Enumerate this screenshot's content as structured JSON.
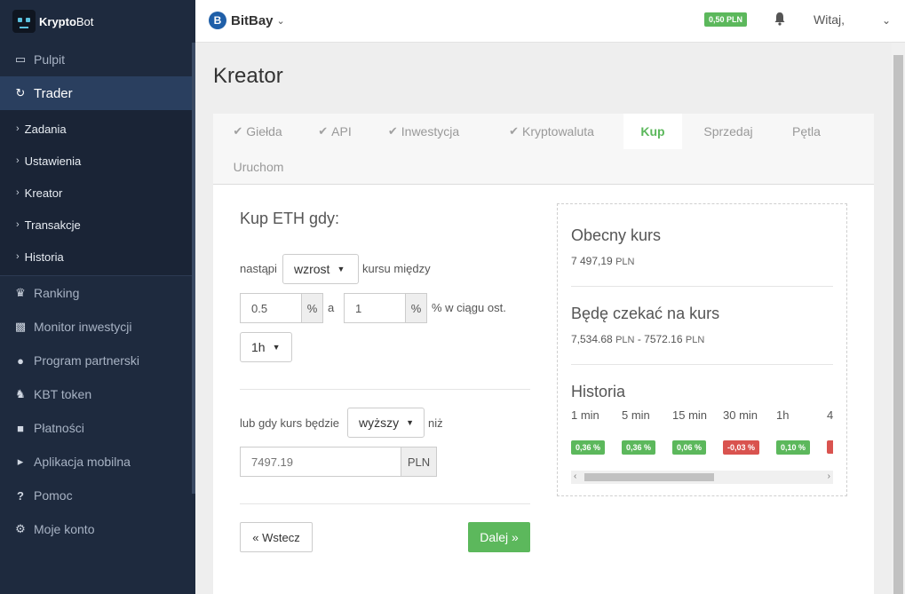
{
  "app": {
    "brand_bold": "Krypto",
    "brand_rest": "Bot"
  },
  "sidebar": {
    "items": [
      {
        "label": "Pulpit",
        "icon": "monitor-icon"
      },
      {
        "label": "Trader",
        "icon": "refresh-icon",
        "active": true
      },
      {
        "label": "Ranking",
        "icon": "trophy-icon"
      },
      {
        "label": "Monitor inwestycji",
        "icon": "bar-chart-icon"
      },
      {
        "label": "Program partnerski",
        "icon": "users-icon"
      },
      {
        "label": "KBT token",
        "icon": "crown-icon"
      },
      {
        "label": "Płatności",
        "icon": "unlock-icon"
      },
      {
        "label": "Aplikacja mobilna",
        "icon": "megaphone-icon"
      },
      {
        "label": "Pomoc",
        "icon": "question-icon"
      },
      {
        "label": "Moje konto",
        "icon": "gears-icon"
      }
    ],
    "subitems": [
      "Zadania",
      "Ustawienia",
      "Kreator",
      "Transakcje",
      "Historia"
    ]
  },
  "topbar": {
    "exchange": "BitBay",
    "exchange_logo": "B",
    "balance": "0,50 PLN",
    "greeting": "Witaj,"
  },
  "page": {
    "title": "Kreator"
  },
  "tabs": [
    {
      "label": "Giełda",
      "done": true
    },
    {
      "label": "API",
      "done": true
    },
    {
      "label": "Inwestycja",
      "done": true
    },
    {
      "label": "Kryptowaluta",
      "done": true
    },
    {
      "label": "Kup",
      "active": true
    },
    {
      "label": "Sprzedaj"
    },
    {
      "label": "Pętla"
    },
    {
      "label": "Uruchom"
    }
  ],
  "form": {
    "heading": "Kup ETH gdy:",
    "happens_label": "nastąpi",
    "direction": "wzrost",
    "between_label": "kursu między",
    "min_pct": "0.5",
    "pct_addon": "%",
    "and_label": "a",
    "max_pct": "1",
    "within_label": "% w ciągu ost.",
    "period": "1h",
    "or_label": "lub gdy kurs będzie",
    "comparison": "wyższy",
    "than_label": "niż",
    "price_placeholder": "7497.19",
    "currency_addon": "PLN",
    "back_button": "« Wstecz",
    "next_button": "Dalej »"
  },
  "panel": {
    "current_title": "Obecny kurs",
    "current_value": "7 497,19",
    "currency": "PLN",
    "wait_title": "Będę czekać na kurs",
    "wait_from": "7,534.68",
    "wait_sep": "-",
    "wait_to": "7572.16",
    "history_title": "Historia",
    "history": [
      {
        "period": "1 min",
        "change": "0,36 %",
        "dir": "pos"
      },
      {
        "period": "5 min",
        "change": "0,36 %",
        "dir": "pos"
      },
      {
        "period": "15 min",
        "change": "0,06 %",
        "dir": "pos"
      },
      {
        "period": "30 min",
        "change": "-0,03 %",
        "dir": "neg"
      },
      {
        "period": "1h",
        "change": "0,10 %",
        "dir": "pos"
      },
      {
        "period": "4",
        "change": "",
        "dir": "neg"
      }
    ]
  }
}
